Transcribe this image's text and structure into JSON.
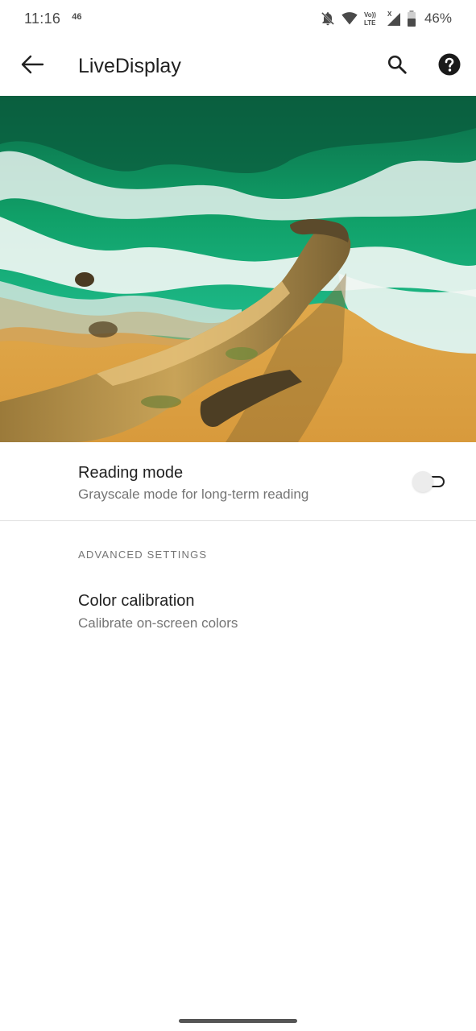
{
  "status_bar": {
    "time": "11:16",
    "network_badge": "46",
    "battery_percent": "46%",
    "icons": [
      "bell-off-icon",
      "wifi-icon",
      "volte-icon",
      "signal-icon",
      "battery-icon"
    ]
  },
  "app_bar": {
    "title": "LiveDisplay",
    "back_icon": "arrow-back-icon",
    "search_icon": "search-icon",
    "help_icon": "help-icon"
  },
  "hero": {
    "image": "aerial-coast-beach-waves"
  },
  "reading_mode": {
    "title": "Reading mode",
    "subtitle": "Grayscale mode for long-term reading",
    "enabled": false
  },
  "advanced_settings": {
    "header": "ADVANCED SETTINGS",
    "color_calibration": {
      "title": "Color calibration",
      "subtitle": "Calibrate on-screen colors"
    }
  },
  "colors": {
    "text_primary": "#212121",
    "text_secondary": "#757575",
    "divider": "#e0e0e0",
    "background": "#ffffff"
  }
}
